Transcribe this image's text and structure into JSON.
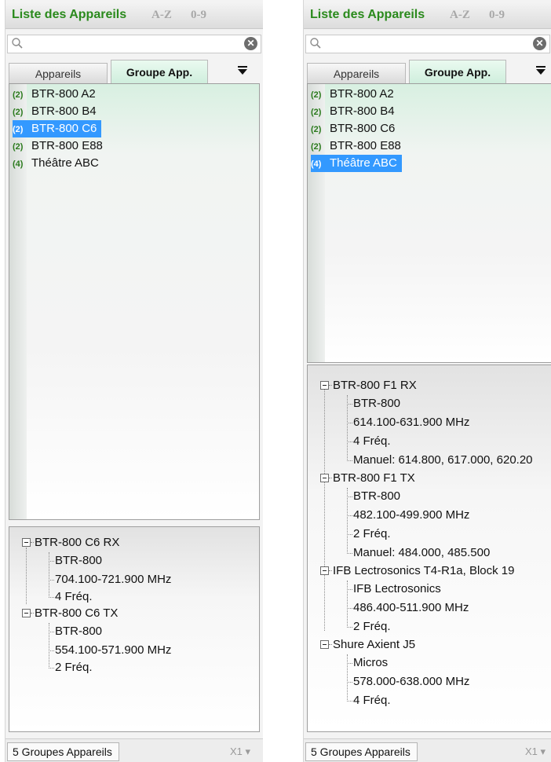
{
  "title": "Liste des Appareils",
  "sort_az": "A-Z",
  "sort_09": "0-9",
  "search": {
    "placeholder": ""
  },
  "tabs": {
    "devices": "Appareils",
    "groups": "Groupe App."
  },
  "colors": {
    "accent_green": "#2a8a1c",
    "selection_blue": "#3399ff"
  },
  "icons": {
    "search": "search-icon",
    "clear": "clear-icon",
    "dropdown": "dropdown-arrow-icon",
    "expander": "collapse-icon"
  },
  "panels": [
    {
      "list": [
        {
          "count": "(2)",
          "name": "BTR-800 A2"
        },
        {
          "count": "(2)",
          "name": "BTR-800 B4"
        },
        {
          "count": "(2)",
          "name": "BTR-800 C6",
          "selected": true
        },
        {
          "count": "(2)",
          "name": "BTR-800 E88"
        },
        {
          "count": "(4)",
          "name": "Théâtre ABC"
        }
      ],
      "tree": [
        {
          "name": "BTR-800 C6 RX",
          "children": [
            "BTR-800",
            "704.100-721.900 MHz",
            "4 Fréq."
          ]
        },
        {
          "name": "BTR-800 C6 TX",
          "children": [
            "BTR-800",
            "554.100-571.900 MHz",
            "2 Fréq."
          ]
        }
      ],
      "status": "5 Groupes Appareils",
      "zoom": "X1"
    },
    {
      "list": [
        {
          "count": "(2)",
          "name": "BTR-800 A2"
        },
        {
          "count": "(2)",
          "name": "BTR-800 B4"
        },
        {
          "count": "(2)",
          "name": "BTR-800 C6"
        },
        {
          "count": "(2)",
          "name": "BTR-800 E88"
        },
        {
          "count": "(4)",
          "name": "Théâtre ABC",
          "selected": true
        }
      ],
      "tree": [
        {
          "name": "BTR-800 F1 RX",
          "children": [
            "BTR-800",
            "614.100-631.900 MHz",
            "4 Fréq.",
            "Manuel: 614.800, 617.000, 620.20"
          ]
        },
        {
          "name": "BTR-800 F1 TX",
          "children": [
            "BTR-800",
            "482.100-499.900 MHz",
            "2 Fréq.",
            "Manuel: 484.000, 485.500"
          ]
        },
        {
          "name": "IFB Lectrosonics T4-R1a, Block 19",
          "children": [
            "IFB Lectrosonics",
            "486.400-511.900 MHz",
            "2 Fréq."
          ]
        },
        {
          "name": "Shure Axient J5",
          "children": [
            "Micros",
            "578.000-638.000 MHz",
            "4 Fréq."
          ]
        }
      ],
      "status": "5 Groupes Appareils",
      "zoom": "X1"
    }
  ]
}
